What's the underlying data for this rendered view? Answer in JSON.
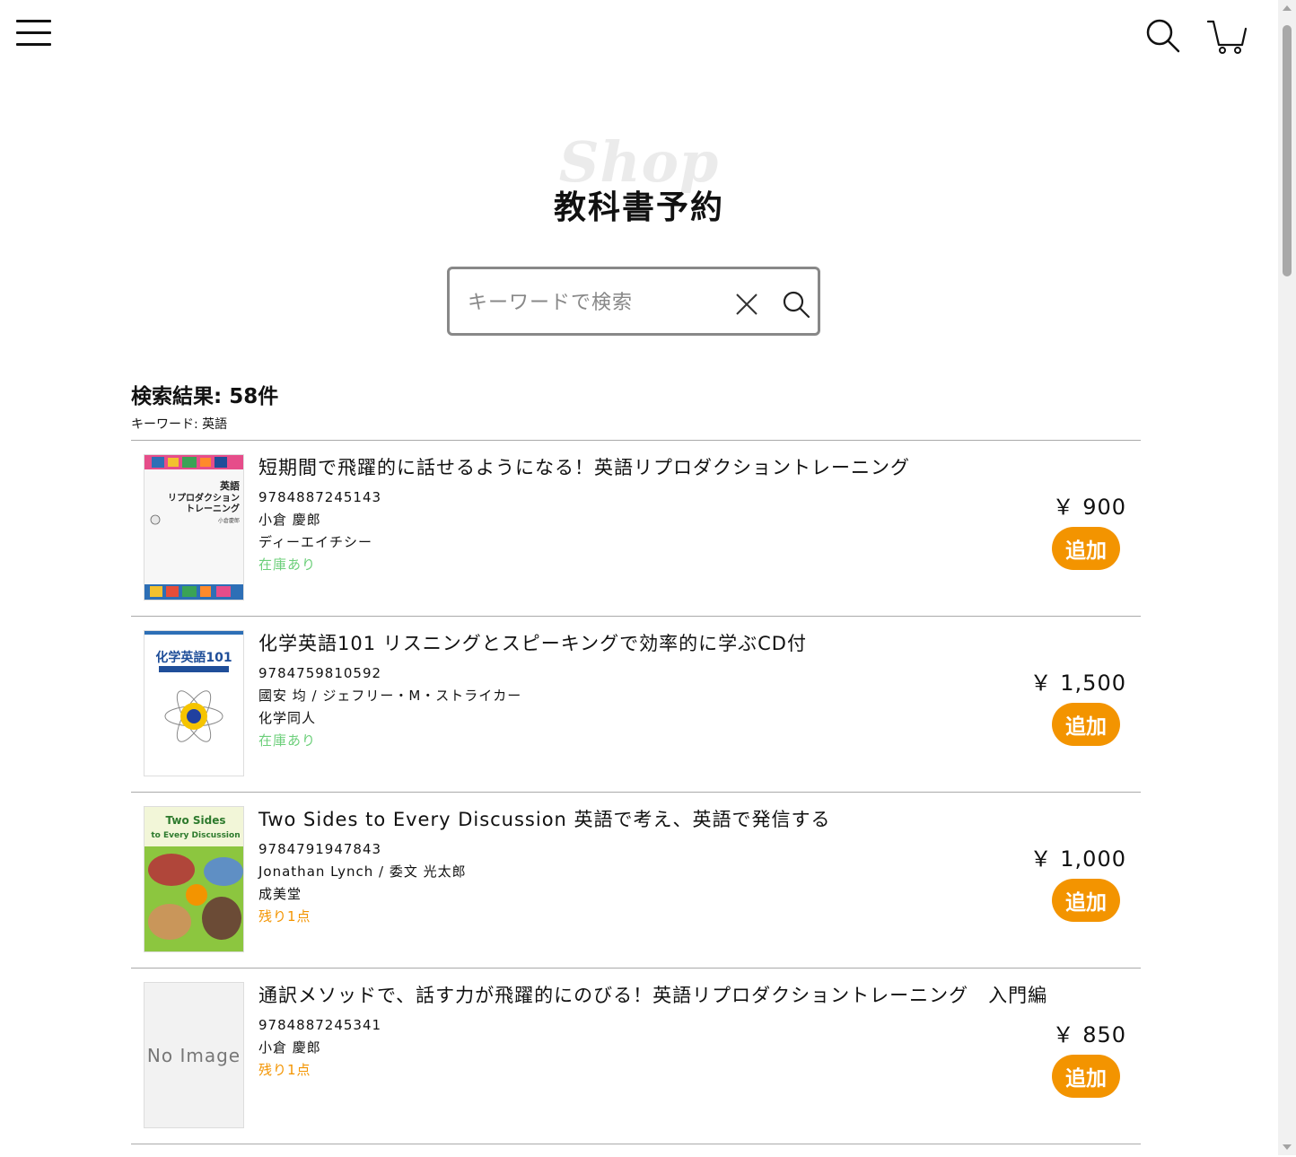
{
  "header": {
    "menu_icon": "hamburger-menu-icon",
    "search_icon": "search-icon",
    "cart_icon": "cart-icon"
  },
  "hero": {
    "bg_text": "Shop",
    "title": "教科書予約"
  },
  "search": {
    "placeholder": "キーワードで検索",
    "value": ""
  },
  "results": {
    "count_label": "検索結果: 58件",
    "keyword_label": "キーワード: 英語"
  },
  "colors": {
    "accent": "#f39400",
    "in_stock": "#6ccf7a",
    "low_stock": "#f39400"
  },
  "items": [
    {
      "title": "短期間で飛躍的に話せるようになる！英語リプロダクショントレーニング",
      "isbn": "9784887245143",
      "author": "小倉 慶郎",
      "publisher": "ディーエイチシー",
      "stock": "在庫あり",
      "stock_status": "in-stock",
      "price": "￥ 900",
      "add_label": "追加",
      "cover_text_1": "英語",
      "cover_text_2": "リプロダクション",
      "cover_text_3": "トレーニング",
      "cover_text_4": "小倉慶郎"
    },
    {
      "title": "化学英語101 リスニングとスピーキングで効率的に学ぶCD付",
      "isbn": "9784759810592",
      "author": "國安 均 / ジェフリー・M・ストライカー",
      "publisher": "化学同人",
      "stock": "在庫あり",
      "stock_status": "in-stock",
      "price": "￥ 1,500",
      "add_label": "追加",
      "cover_text_1": "化学英語101"
    },
    {
      "title": "Two Sides to Every Discussion 英語で考え、英語で発信する",
      "isbn": "9784791947843",
      "author": "Jonathan Lynch / 委文 光太郎",
      "publisher": "成美堂",
      "stock": "残り1点",
      "stock_status": "low-stock",
      "price": "￥ 1,000",
      "add_label": "追加",
      "cover_text_1": "Two Sides",
      "cover_text_2": "to Every Discussion"
    },
    {
      "title": "通訳メソッドで、話す力が飛躍的にのびる！英語リプロダクショントレーニング　入門編",
      "isbn": "9784887245341",
      "author": "小倉 慶郎",
      "stock": "残り1点",
      "stock_status": "low-stock",
      "price": "￥ 850",
      "add_label": "追加",
      "cover_placeholder": "No Image"
    }
  ]
}
